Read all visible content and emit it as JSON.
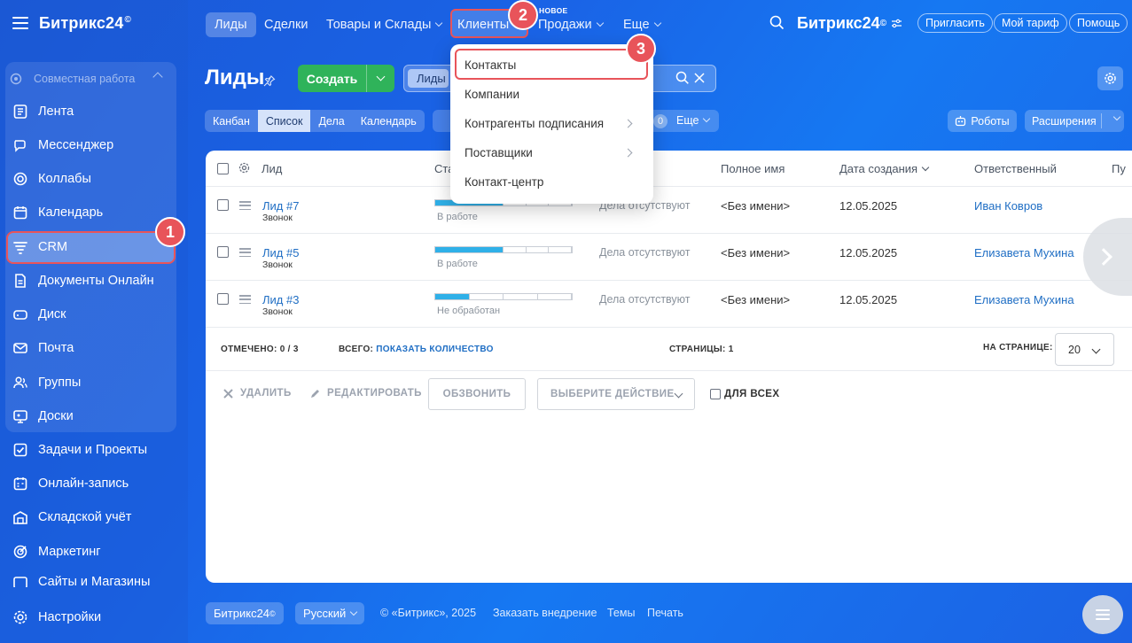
{
  "sidebar": {
    "logo": "Битрикс24",
    "logo_mark": "©",
    "group_title": "Совместная работа",
    "items": [
      {
        "label": "Лента"
      },
      {
        "label": "Мессенджер"
      },
      {
        "label": "Коллабы"
      },
      {
        "label": "Календарь"
      },
      {
        "label": "CRM"
      },
      {
        "label": "Документы Онлайн"
      },
      {
        "label": "Диск"
      },
      {
        "label": "Почта"
      },
      {
        "label": "Группы"
      },
      {
        "label": "Доски"
      },
      {
        "label": "Задачи и Проекты"
      },
      {
        "label": "Онлайн-запись"
      },
      {
        "label": "Складской учёт"
      },
      {
        "label": "Маркетинг"
      },
      {
        "label": "Сайты и Магазины"
      }
    ],
    "settings": "Настройки"
  },
  "topnav": {
    "items": [
      "Лиды",
      "Сделки",
      "Товары и Склады",
      "Клиенты",
      "Продажи",
      "Еще"
    ],
    "new_tag": "НОВОЕ",
    "brand": "Битрикс24",
    "brand_mark": "©",
    "invite": "Пригласить",
    "tariff": "Мой тариф",
    "help": "Помощь"
  },
  "badges": [
    "1",
    "2",
    "3"
  ],
  "page": {
    "title": "Лиды",
    "create": "Создать",
    "search_chip": "Лиды",
    "view_tabs": [
      "Канбан",
      "Список",
      "Дела",
      "Календарь"
    ],
    "counter_zero": "0",
    "more": "Еще",
    "robots": "Роботы",
    "extensions": "Расширения"
  },
  "dropdown": {
    "items": [
      "Контакты",
      "Компании",
      "Контрагенты подписания",
      "Поставщики",
      "Контакт-центр"
    ]
  },
  "grid": {
    "headers": {
      "lead": "Лид",
      "stage": "Ста",
      "full_name": "Полное имя",
      "created": "Дата создания",
      "responsible": "Ответственный",
      "extra": "Пу"
    },
    "rows": [
      {
        "title": "Лид #7",
        "source": "Звонок",
        "stage": "В работе",
        "stage_progress": 0.5,
        "activity": "Дела отсутствуют",
        "name": "<Без имени>",
        "date": "12.05.2025",
        "responsible": "Иван Ковров"
      },
      {
        "title": "Лид #5",
        "source": "Звонок",
        "stage": "В работе",
        "stage_progress": 0.5,
        "activity": "Дела отсутствуют",
        "name": "<Без имени>",
        "date": "12.05.2025",
        "responsible": "Елизавета Мухина"
      },
      {
        "title": "Лид #3",
        "source": "Звонок",
        "stage": "Не обработан",
        "stage_progress": 0.25,
        "activity": "Дела отсутствуют",
        "name": "<Без имени>",
        "date": "12.05.2025",
        "responsible": "Елизавета Мухина"
      }
    ],
    "footer": {
      "selected_label": "ОТМЕЧЕНО:",
      "selected_value": "0 / 3",
      "total_label": "ВСЕГО:",
      "total_link": "ПОКАЗАТЬ КОЛИЧЕСТВО",
      "pages_label": "СТРАНИЦЫ:",
      "pages_value": "1",
      "per_page_label": "НА СТРАНИЦЕ:",
      "per_page_value": "20"
    },
    "actions": {
      "delete": "УДАЛИТЬ",
      "edit": "РЕДАКТИРОВАТЬ",
      "call": "ОБЗВОНИТЬ",
      "choose": "ВЫБЕРИТЕ ДЕЙСТВИЕ",
      "for_all": "ДЛЯ ВСЕХ"
    }
  },
  "footer": {
    "brand": "Битрикс24",
    "brand_mark": "©",
    "language": "Русский",
    "copyright": "© «Битрикс», 2025",
    "order": "Заказать внедрение",
    "themes": "Темы",
    "print": "Печать"
  },
  "colors": {
    "accent_red": "#e8545a",
    "create_green": "#2fb35a",
    "link_blue": "#1f6ec4",
    "progress_blue": "#2fb0e8"
  }
}
